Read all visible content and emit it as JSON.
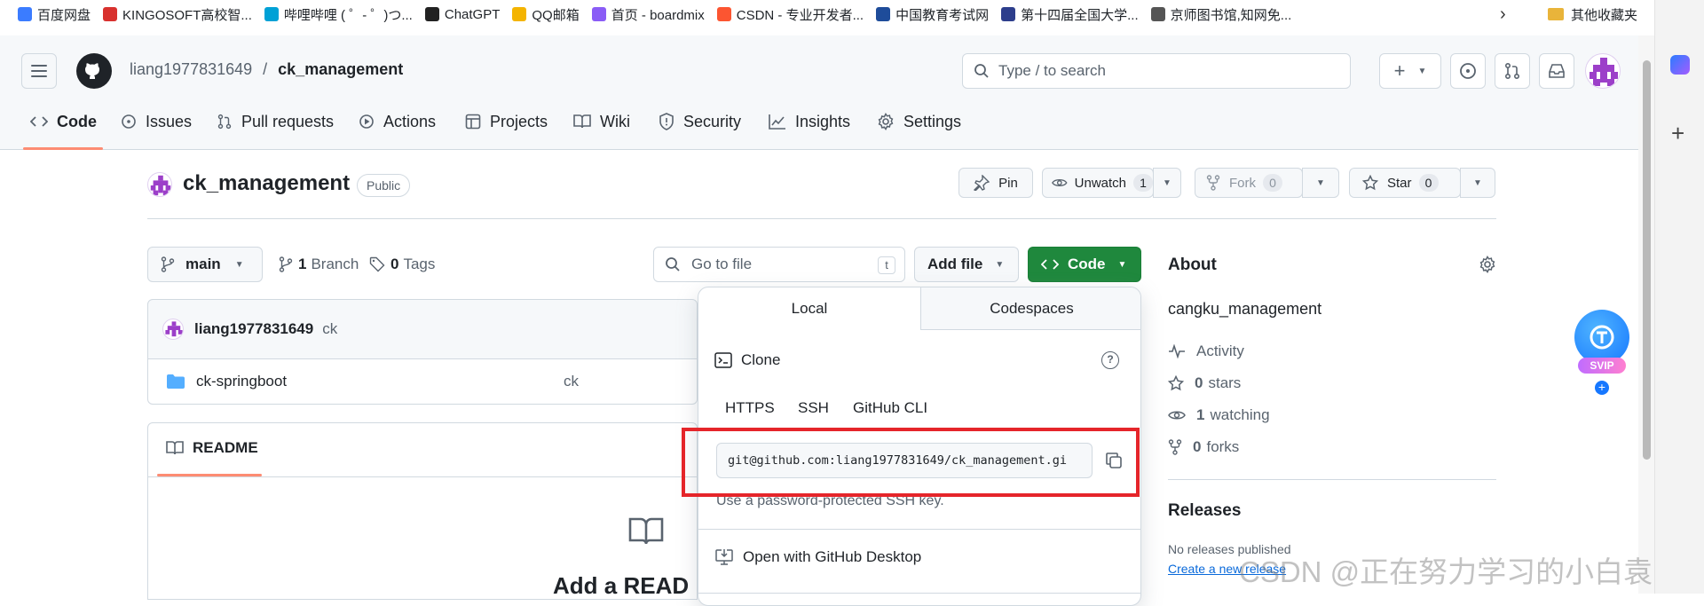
{
  "bookmarks": [
    {
      "label": "百度网盘",
      "icon": "baidu-cloud-icon",
      "color": "#3b7cff"
    },
    {
      "label": "KINGOSOFT高校智...",
      "icon": "kingosoft-icon",
      "color": "#d8312e"
    },
    {
      "label": "哔哩哔哩 ( ゜- ゜)つ...",
      "icon": "bilibili-icon",
      "color": "#00a1d6"
    },
    {
      "label": "ChatGPT",
      "icon": "openai-icon",
      "color": "#222222"
    },
    {
      "label": "QQ邮箱",
      "icon": "qq-mail-icon",
      "color": "#f4b400"
    },
    {
      "label": "首页 - boardmix",
      "icon": "boardmix-icon",
      "color": "#8a5cf6"
    },
    {
      "label": "CSDN - 专业开发者...",
      "icon": "csdn-icon",
      "color": "#fc5531"
    },
    {
      "label": "中国教育考试网",
      "icon": "neea-icon",
      "color": "#1e4c9a"
    },
    {
      "label": "第十四届全国大学...",
      "icon": "contest-icon",
      "color": "#2d3e8c"
    },
    {
      "label": "京师图书馆,知网免...",
      "icon": "page-icon",
      "color": "#555555"
    }
  ],
  "bookmarks_overflow": "其他收藏夹",
  "header": {
    "owner": "liang1977831649",
    "separator": "/",
    "repo": "ck_management",
    "search_placeholder": "Type / to search"
  },
  "tabs": [
    {
      "label": "Code",
      "icon": "code-icon",
      "active": true
    },
    {
      "label": "Issues",
      "icon": "issue-icon"
    },
    {
      "label": "Pull requests",
      "icon": "pull-request-icon"
    },
    {
      "label": "Actions",
      "icon": "play-icon"
    },
    {
      "label": "Projects",
      "icon": "table-icon"
    },
    {
      "label": "Wiki",
      "icon": "book-icon"
    },
    {
      "label": "Security",
      "icon": "shield-icon"
    },
    {
      "label": "Insights",
      "icon": "graph-icon"
    },
    {
      "label": "Settings",
      "icon": "gear-icon"
    }
  ],
  "repo": {
    "name": "ck_management",
    "visibility": "Public",
    "pin": "Pin",
    "unwatch": "Unwatch",
    "watch_count": "1",
    "fork": "Fork",
    "fork_count": "0",
    "star": "Star",
    "star_count": "0"
  },
  "toolbar": {
    "branch": "main",
    "branch_count": "1",
    "branch_label": "Branch",
    "tag_count": "0",
    "tag_label": "Tags",
    "goto_placeholder": "Go to file",
    "goto_kbd": "t",
    "add_file": "Add file",
    "code": "Code"
  },
  "commit": {
    "author": "liang1977831649",
    "message": "ck"
  },
  "files": [
    {
      "name": "ck-springboot",
      "message": "ck"
    }
  ],
  "readme": {
    "tab": "README",
    "heading": "Add a READ"
  },
  "clone_popup": {
    "tabs": [
      "Local",
      "Codespaces"
    ],
    "title": "Clone",
    "protocols": [
      "HTTPS",
      "SSH",
      "GitHub CLI"
    ],
    "url": "git@github.com:liang1977831649/ck_management.gi",
    "hint": "Use a password-protected SSH key.",
    "open_desktop": "Open with GitHub Desktop"
  },
  "about": {
    "title": "About",
    "description": "cangku_management",
    "activity": "Activity",
    "stars_num": "0",
    "stars_label": "stars",
    "watching_num": "1",
    "watching_label": "watching",
    "forks_num": "0",
    "forks_label": "forks"
  },
  "releases": {
    "title": "Releases",
    "none": "No releases published",
    "create": "Create a new release"
  },
  "floating_badge": "SVIP",
  "watermark": "CSDN @正在努力学习的小白袁",
  "colors": {
    "primary_green": "#1f883d",
    "highlight_red": "#e5252a",
    "tab_underline": "#fd8c73",
    "link": "#0969da"
  }
}
